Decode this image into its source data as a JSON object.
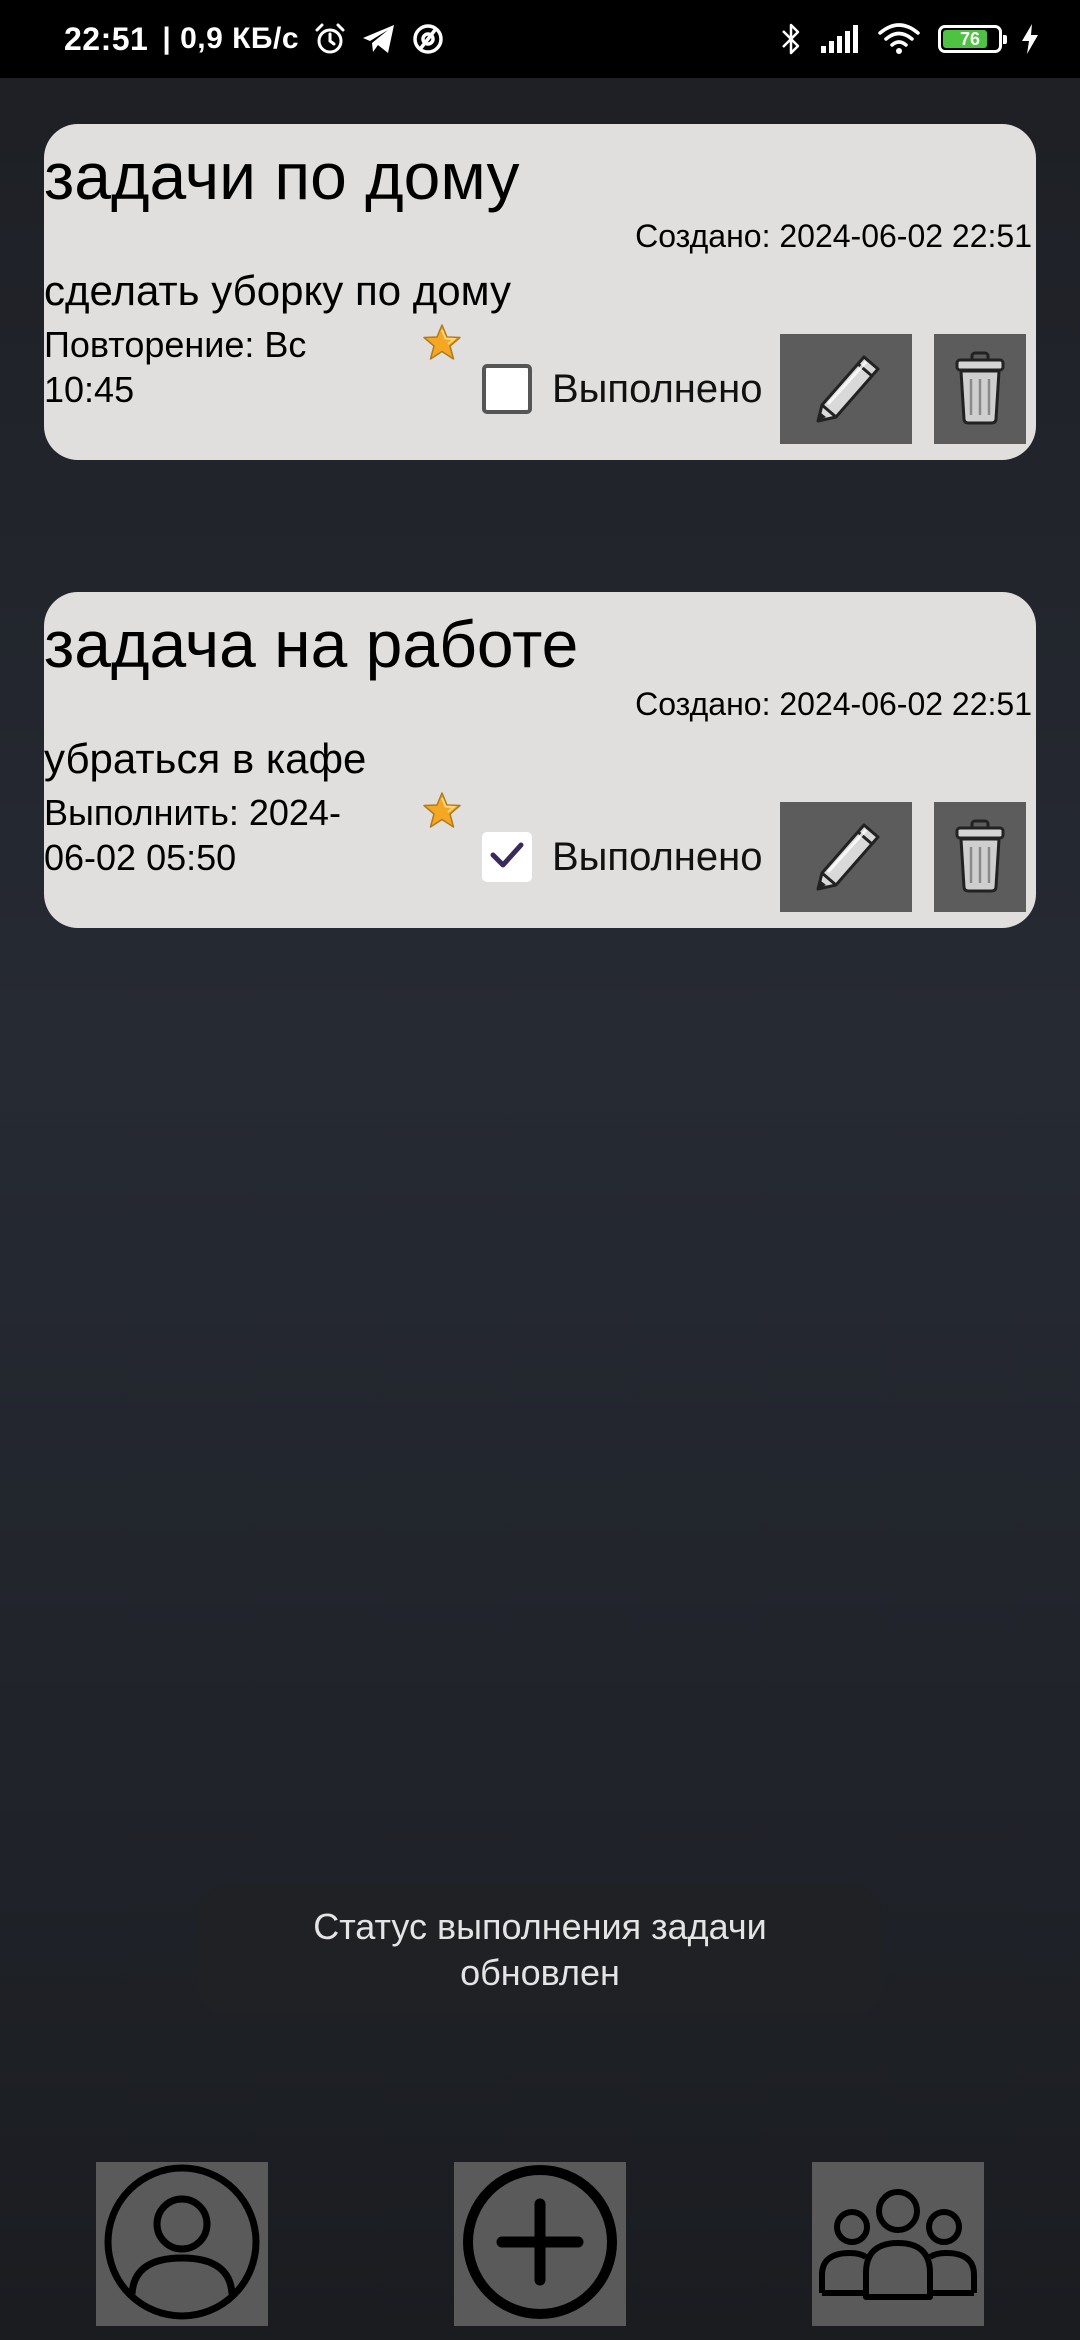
{
  "status_bar": {
    "time": "22:51",
    "network_speed": "| 0,9 КБ/с",
    "battery_level": "76",
    "icons": [
      "alarm-icon",
      "telegram-icon",
      "vpn-icon",
      "bluetooth-icon",
      "signal-icon",
      "wifi-icon",
      "battery-icon",
      "charging-icon"
    ]
  },
  "tasks": [
    {
      "title": "задачи по дому",
      "created": "Создано: 2024-06-02 22:51",
      "description": "сделать уборку по дому",
      "schedule": "Повторение: Вс 10:45",
      "done_label": "Выполнено",
      "done": false,
      "starred": true
    },
    {
      "title": "задача на работе",
      "created": "Создано: 2024-06-02 22:51",
      "description": "убраться в кафе",
      "schedule": "Выполнить: 2024-06-02 05:50",
      "done_label": "Выполнено",
      "done": true,
      "starred": true
    }
  ],
  "toast": {
    "message": "Статус выполнения задачи обновлен"
  },
  "bottom_nav": {
    "items": [
      "profile-icon",
      "add-task-icon",
      "groups-icon"
    ]
  },
  "colors": {
    "card_background": "#e1dfdd",
    "button_background": "#5c5c5c",
    "checkmark": "#3a2a5c",
    "star": "#f5a623"
  }
}
